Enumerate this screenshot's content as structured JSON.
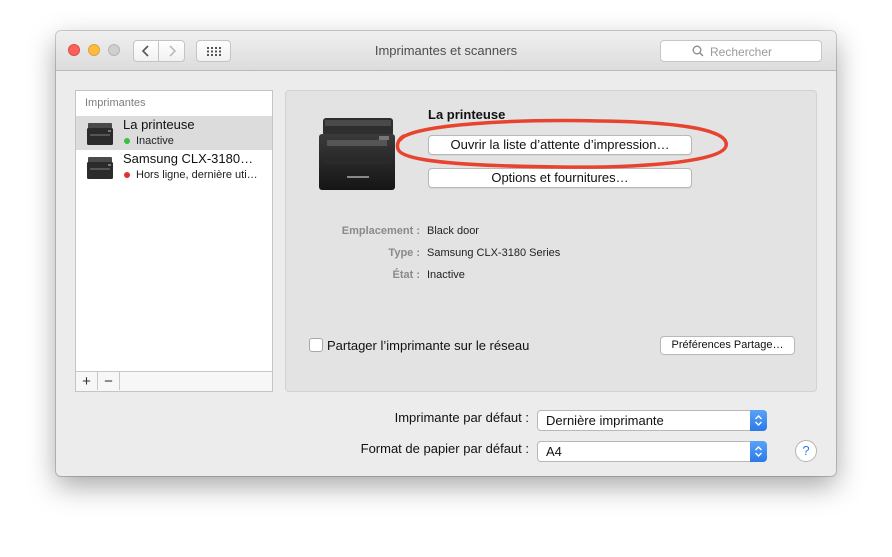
{
  "window": {
    "title": "Imprimantes et scanners",
    "search_placeholder": "Rechercher"
  },
  "sidebar": {
    "header": "Imprimantes",
    "printers": [
      {
        "name": "La printeuse",
        "status": "Inactive",
        "status_color": "#3bbf3f",
        "selected": true
      },
      {
        "name": "Samsung CLX-3180…",
        "status": "Hors ligne, dernière uti…",
        "status_color": "#e5302b",
        "selected": false
      }
    ],
    "add_label": "+",
    "remove_label": "−"
  },
  "detail": {
    "printer_name": "La printeuse",
    "open_queue_label": "Ouvrir la liste d’attente d’impression…",
    "options_label": "Options et fournitures…",
    "info": [
      {
        "label": "Emplacement :",
        "value": "Black door"
      },
      {
        "label": "Type :",
        "value": "Samsung CLX-3180 Series"
      },
      {
        "label": "État :",
        "value": "Inactive"
      }
    ],
    "share_label": "Partager l’imprimante sur le réseau",
    "share_checked": false,
    "share_prefs_label": "Préférences Partage…"
  },
  "defaults": {
    "printer_label": "Imprimante par défaut :",
    "printer_value": "Dernière imprimante",
    "paper_label": "Format de papier par défaut :",
    "paper_value": "A4",
    "help_label": "?"
  },
  "colors": {
    "accent": "#2a7ae8",
    "annotation": "#e8432f"
  }
}
